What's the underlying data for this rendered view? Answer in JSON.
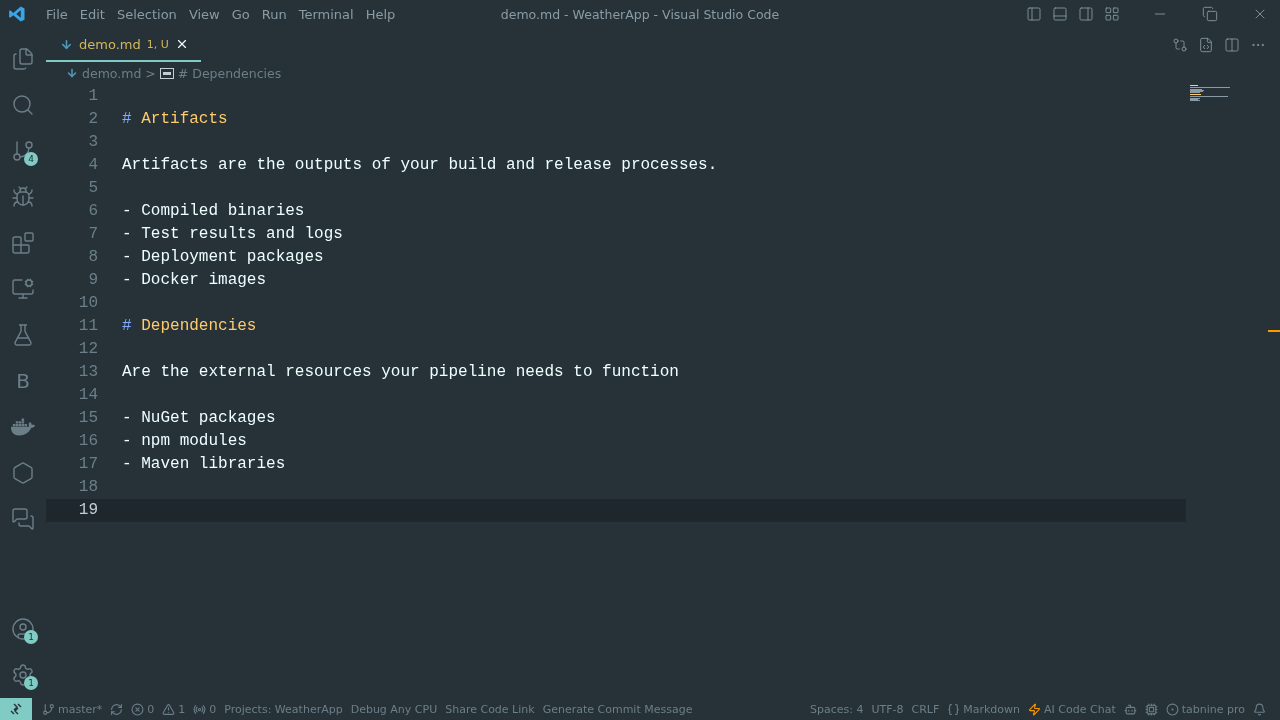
{
  "window": {
    "title": "demo.md - WeatherApp - Visual Studio Code"
  },
  "menu": [
    "File",
    "Edit",
    "Selection",
    "View",
    "Go",
    "Run",
    "Terminal",
    "Help"
  ],
  "activity_bar": {
    "top": [
      {
        "kind": "files"
      },
      {
        "kind": "search"
      },
      {
        "kind": "source-control",
        "badge": "4"
      },
      {
        "kind": "run-debug"
      },
      {
        "kind": "extensions"
      },
      {
        "kind": "remote"
      },
      {
        "kind": "testing"
      },
      {
        "kind": "letter",
        "label": "B"
      },
      {
        "kind": "docker"
      },
      {
        "kind": "hexagon"
      },
      {
        "kind": "chat"
      }
    ],
    "bottom": [
      {
        "kind": "account",
        "badge": "1"
      },
      {
        "kind": "settings",
        "badge": "1"
      }
    ]
  },
  "tabs": [
    {
      "label": "demo.md",
      "decoration": "1, U",
      "selected": true
    }
  ],
  "breadcrumbs": {
    "file": "demo.md",
    "separator": ">",
    "symbol": "# Dependencies"
  },
  "lines": [
    {
      "number": "1",
      "kind": "blank",
      "selected": false
    },
    {
      "number": "2",
      "kind": "heading",
      "marker": "#",
      "text": "Artifacts",
      "selected": false
    },
    {
      "number": "3",
      "kind": "blank",
      "selected": false
    },
    {
      "number": "4",
      "kind": "text",
      "text": "Artifacts are the outputs of your build and release processes.",
      "selected": false
    },
    {
      "number": "5",
      "kind": "blank",
      "selected": false
    },
    {
      "number": "6",
      "kind": "list",
      "marker": "-",
      "text": "Compiled binaries",
      "selected": false
    },
    {
      "number": "7",
      "kind": "list",
      "marker": "-",
      "text": "Test results and logs",
      "selected": false
    },
    {
      "number": "8",
      "kind": "list",
      "marker": "-",
      "text": "Deployment packages",
      "selected": false
    },
    {
      "number": "9",
      "kind": "list",
      "marker": "-",
      "text": "Docker images",
      "selected": false
    },
    {
      "number": "10",
      "kind": "blank",
      "selected": false
    },
    {
      "number": "11",
      "kind": "heading",
      "marker": "#",
      "text": "Dependencies",
      "selected": false
    },
    {
      "number": "12",
      "kind": "blank",
      "selected": false
    },
    {
      "number": "13",
      "kind": "text",
      "text": "Are the external resources your pipeline needs to function",
      "selected": false
    },
    {
      "number": "14",
      "kind": "blank",
      "selected": false
    },
    {
      "number": "15",
      "kind": "list",
      "marker": "-",
      "text": "NuGet packages",
      "selected": false
    },
    {
      "number": "16",
      "kind": "list",
      "marker": "-",
      "text": "npm modules",
      "selected": false
    },
    {
      "number": "17",
      "kind": "list",
      "marker": "-",
      "text": "Maven libraries",
      "selected": false
    },
    {
      "number": "18",
      "kind": "blank",
      "selected": false
    },
    {
      "number": "19",
      "kind": "blank",
      "selected": true
    }
  ],
  "status_bar": {
    "left": [
      {
        "kind": "branch",
        "text": "master*"
      },
      {
        "kind": "sync"
      },
      {
        "kind": "errors",
        "text": "0"
      },
      {
        "kind": "warnings",
        "text": "1"
      },
      {
        "kind": "ports",
        "text": "0"
      },
      {
        "kind": "plain",
        "text": "Projects: WeatherApp"
      },
      {
        "kind": "plain",
        "text": "Debug Any CPU"
      },
      {
        "kind": "plain",
        "text": "Share Code Link"
      },
      {
        "kind": "plain",
        "text": "Generate Commit Message"
      }
    ],
    "right": [
      {
        "kind": "plain",
        "text": "Spaces: 4"
      },
      {
        "kind": "plain",
        "text": "UTF-8"
      },
      {
        "kind": "plain",
        "text": "CRLF"
      },
      {
        "kind": "language",
        "text": "Markdown"
      },
      {
        "kind": "ai",
        "text": "AI Code Chat"
      },
      {
        "kind": "copilot"
      },
      {
        "kind": "extension"
      },
      {
        "kind": "tabnine",
        "text": "tabnine pro"
      },
      {
        "kind": "bell"
      }
    ]
  }
}
